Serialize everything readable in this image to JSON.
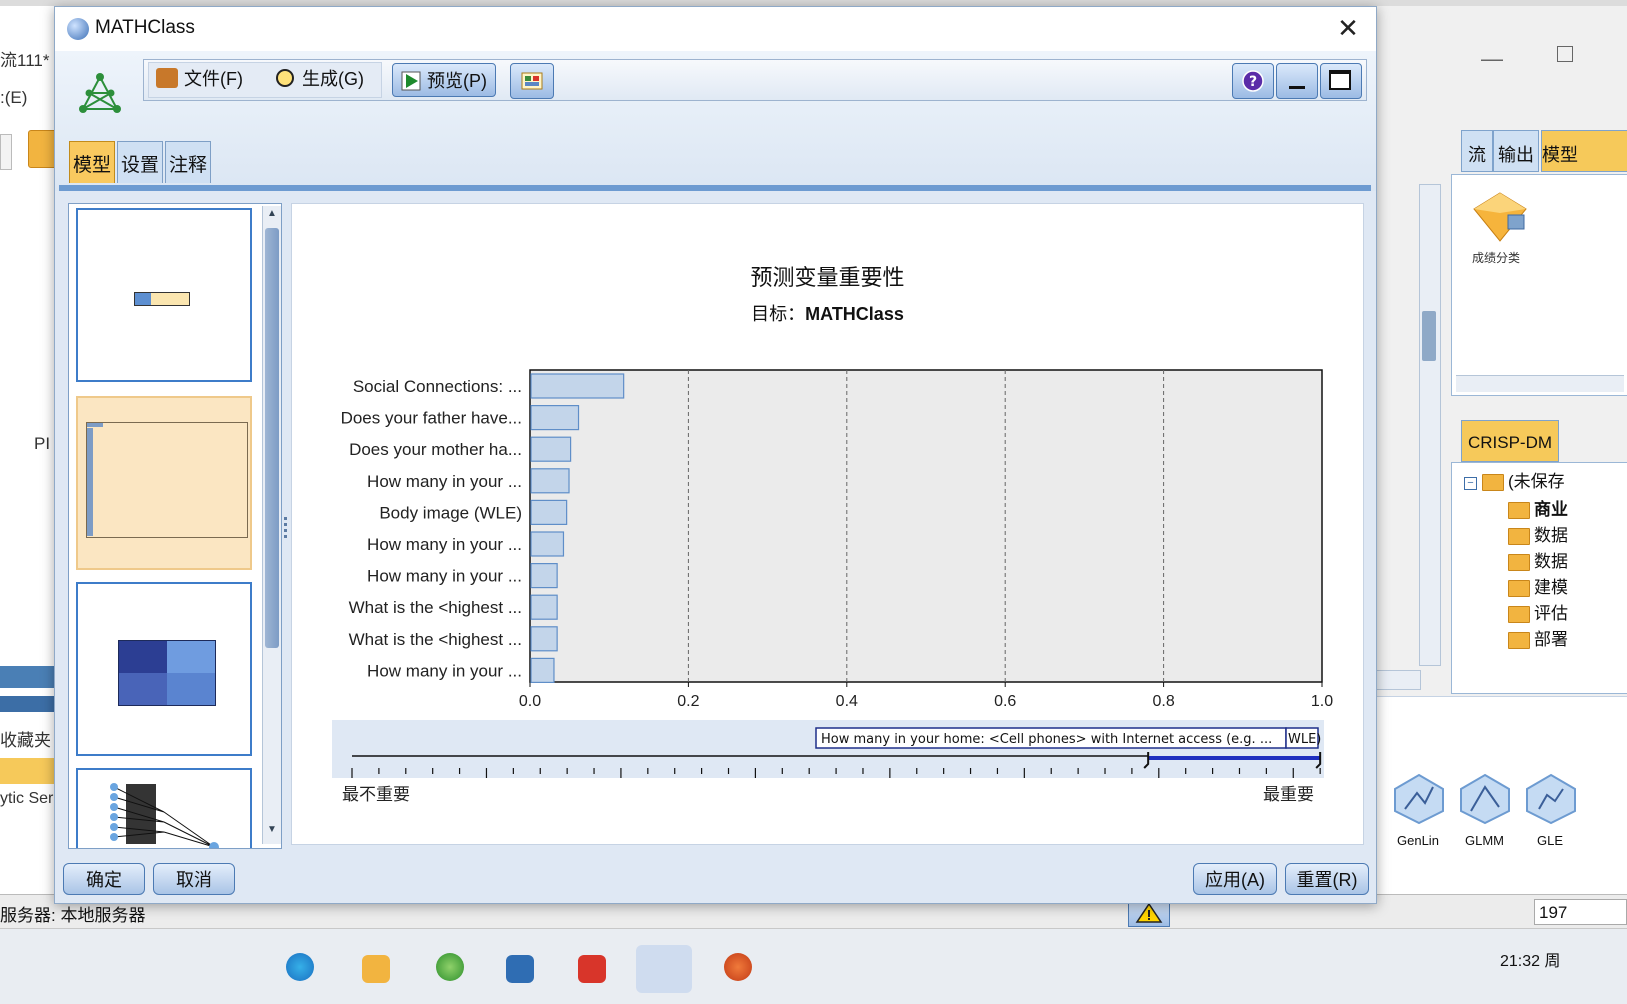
{
  "background": {
    "left_texts": [
      "流111*",
      ":(E)",
      "PI",
      "收藏夹",
      "ytic Ser"
    ],
    "right_tabs": [
      "流",
      "输出",
      "模型"
    ],
    "model_node_label": "成绩分类",
    "crisp_tab": "CRISP-DM",
    "tree": [
      "(未保存",
      "商业",
      "数据",
      "数据",
      "建模",
      "评估",
      "部署"
    ],
    "palette": [
      "GenLin",
      "GLMM",
      "GLE"
    ],
    "status_left": "服务器: 本地服务器",
    "status_right": "197",
    "clock": "21:32 周"
  },
  "dialog": {
    "title": "MATHClass",
    "menu": {
      "file": "文件(F)",
      "generate": "生成(G)",
      "preview": "预览(P)"
    },
    "tabs": [
      "模型",
      "设置",
      "注释"
    ],
    "buttons": {
      "ok": "确定",
      "cancel": "取消",
      "apply": "应用(A)",
      "reset": "重置(R)"
    }
  },
  "chart_data": {
    "type": "bar",
    "orientation": "horizontal",
    "title": "预测变量重要性",
    "subtitle_label": "目标：",
    "subtitle_value": "MATHClass",
    "categories": [
      "Social Connections: ...",
      "Does your father have...",
      "Does your mother ha...",
      "How many in your ...",
      "Body image (WLE)",
      "How many in your ...",
      "How many in your ...",
      "What is the <highest ...",
      "What is the <highest ...",
      "How many in your ..."
    ],
    "values": [
      0.117,
      0.06,
      0.05,
      0.048,
      0.045,
      0.041,
      0.033,
      0.033,
      0.033,
      0.029
    ],
    "xlim": [
      0,
      1
    ],
    "xticks": [
      "0.0",
      "0.2",
      "0.4",
      "0.6",
      "0.8",
      "1.0"
    ],
    "grid": true,
    "slider": {
      "label": "How many in your home: <Cell phones> with Internet access (e.g. ...",
      "label_end": "WLE)",
      "left_label": "最不重要",
      "right_label": "最重要",
      "range": [
        0.73,
        0.98
      ]
    }
  }
}
